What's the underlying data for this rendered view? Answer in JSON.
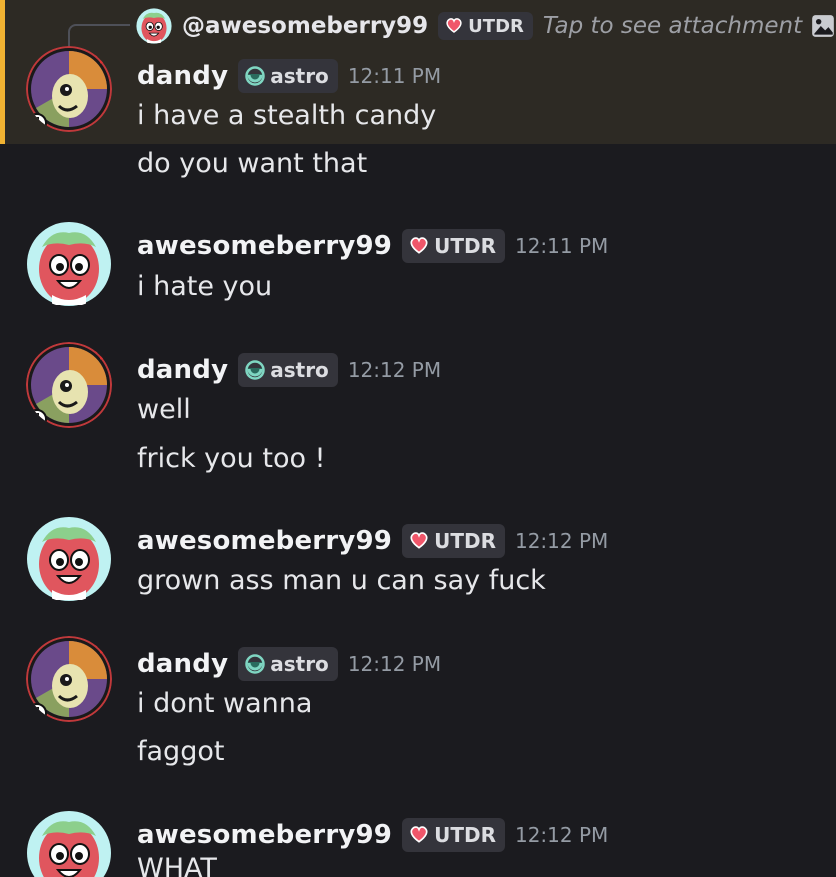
{
  "reply": {
    "author": "@awesomeberry99",
    "tag": "UTDR",
    "text": "Tap to see attachment"
  },
  "messages": [
    {
      "author": "dandy",
      "tag": "astro",
      "time": "12:11 PM",
      "lines": [
        "i have a stealth candy",
        "do you want that"
      ]
    },
    {
      "author": "awesomeberry99",
      "tag": "UTDR",
      "time": "12:11 PM",
      "lines": [
        "i hate you"
      ]
    },
    {
      "author": "dandy",
      "tag": "astro",
      "time": "12:12 PM",
      "lines": [
        "well",
        "frick you too !"
      ]
    },
    {
      "author": "awesomeberry99",
      "tag": "UTDR",
      "time": "12:12 PM",
      "lines": [
        "grown ass man u can say fuck"
      ]
    },
    {
      "author": "dandy",
      "tag": "astro",
      "time": "12:12 PM",
      "lines": [
        "i dont wanna",
        "faggot"
      ]
    },
    {
      "author": "awesomeberry99",
      "tag": "UTDR",
      "time": "12:12 PM",
      "lines": [
        "WHAT"
      ]
    }
  ],
  "colors": {
    "background": "#1b1b1f",
    "highlight_background": "#2d2a24",
    "highlight_border": "#f0b232",
    "timestamp": "#949ba4",
    "utdr_heart": "#f0566a",
    "astro_icon": "#7fd6c2"
  },
  "icons": {
    "utdr": "heart-icon",
    "astro": "astro-moon-icon",
    "attachment": "image-icon"
  }
}
